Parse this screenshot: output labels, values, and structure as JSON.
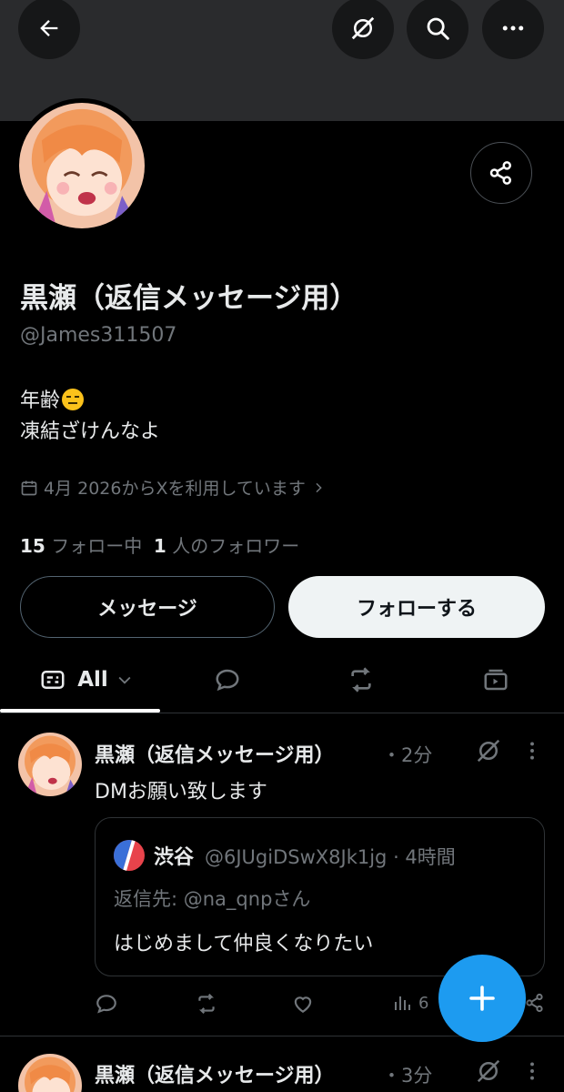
{
  "profile": {
    "display_name": "黒瀬（返信メッセージ用）",
    "handle": "@James311507",
    "bio_line1": "年齢",
    "bio_line2": "凍結ざけんなよ",
    "joined": "4月 2026からXを利用しています",
    "following_count": "15",
    "following_label": "フォロー中",
    "followers_count": "1",
    "followers_label": "人のフォロワー"
  },
  "buttons": {
    "message": "メッセージ",
    "follow": "フォローする"
  },
  "tabs": {
    "all_label": "All",
    "icons": [
      "posts-filter-icon",
      "reply-icon",
      "repost-icon",
      "media-icon"
    ]
  },
  "posts": [
    {
      "name": "黒瀬（返信メッセージ用）",
      "sep": "・",
      "time": "2分",
      "text": "DMお願い致します",
      "quote": {
        "name": "渋谷",
        "handle_time": "@6JUgiDSwX8Jk1jg · 4時間",
        "reply_to": "返信先: @na_qnpさん",
        "text": "はじめまして仲良くなりたい"
      },
      "views": "6"
    },
    {
      "name": "黒瀬（返信メッセージ用）",
      "sep": "・",
      "time": "3分"
    }
  ],
  "colors": {
    "accent": "#1d9bf0",
    "background": "#000000",
    "banner": "#2a2b2d",
    "secondary_text": "#71767b",
    "primary_text": "#e7e9ea"
  }
}
